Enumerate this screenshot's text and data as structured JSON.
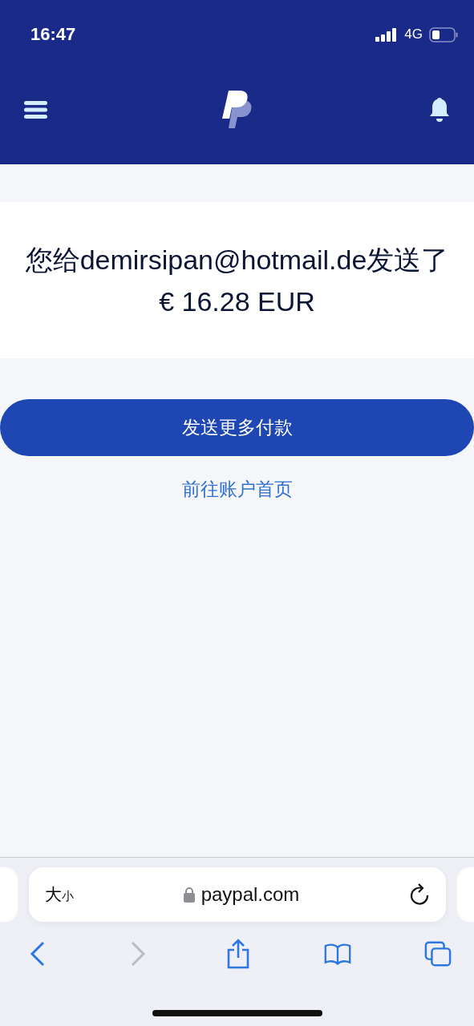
{
  "status_bar": {
    "time": "16:47",
    "network": "4G"
  },
  "confirmation": {
    "message": "您给demirsipan@hotmail.de发送了€ 16.28 EUR"
  },
  "actions": {
    "primary": "发送更多付款",
    "link": "前往账户首页"
  },
  "browser": {
    "text_size": {
      "large": "大",
      "small": "小"
    },
    "url": "paypal.com",
    "nav": [
      {
        "kind": "back",
        "disabled": false
      },
      {
        "kind": "forward",
        "disabled": true
      },
      {
        "kind": "share",
        "disabled": false
      },
      {
        "kind": "bookmarks",
        "disabled": false
      },
      {
        "kind": "tabs",
        "disabled": false
      }
    ]
  }
}
